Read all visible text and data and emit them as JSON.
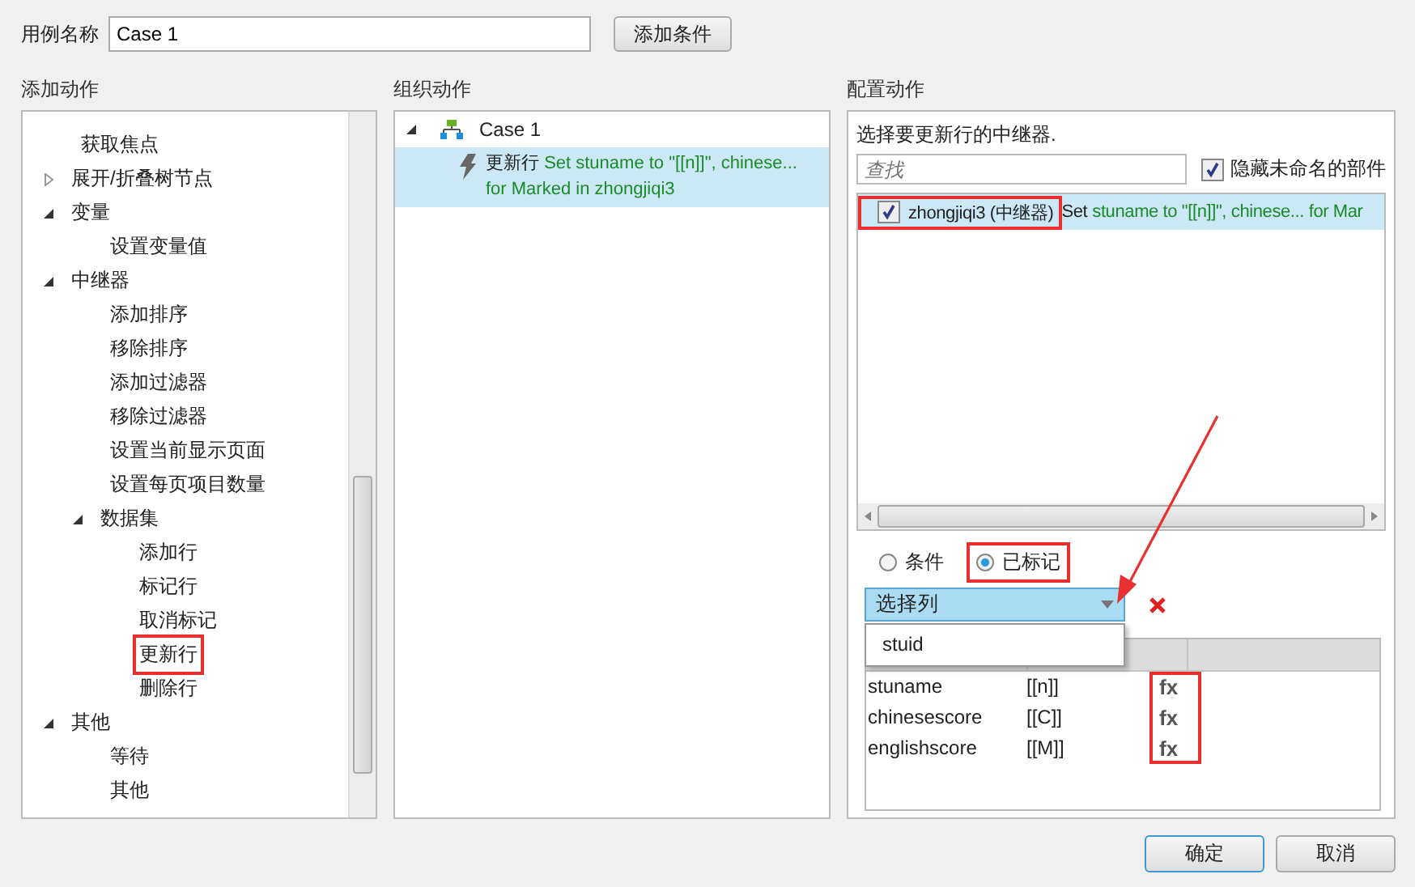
{
  "case_name": {
    "label": "用例名称",
    "value": "Case 1"
  },
  "add_condition_button": "添加条件",
  "add_actions": {
    "title": "添加动作",
    "tree": [
      {
        "label": "获取焦点"
      },
      {
        "label": "展开/折叠树节点",
        "expanded": false
      },
      {
        "label": "变量",
        "expanded": true,
        "children": [
          {
            "label": "设置变量值"
          }
        ]
      },
      {
        "label": "中继器",
        "expanded": true,
        "children": [
          {
            "label": "添加排序"
          },
          {
            "label": "移除排序"
          },
          {
            "label": "添加过滤器"
          },
          {
            "label": "移除过滤器"
          },
          {
            "label": "设置当前显示页面"
          },
          {
            "label": "设置每页项目数量"
          },
          {
            "label": "数据集",
            "expanded": true,
            "children": [
              {
                "label": "添加行",
                "highlighted": false
              },
              {
                "label": "标记行",
                "highlighted": false
              },
              {
                "label": "取消标记",
                "highlighted": false
              },
              {
                "label": "更新行",
                "highlighted": true
              },
              {
                "label": "删除行",
                "highlighted": false
              }
            ]
          }
        ]
      },
      {
        "label": "其他",
        "expanded": true,
        "children": [
          {
            "label": "等待"
          },
          {
            "label": "其他"
          }
        ]
      }
    ]
  },
  "organize_actions": {
    "title": "组织动作",
    "cases": [
      {
        "label": "Case 1",
        "expanded": true,
        "actions": [
          {
            "name": "更新行",
            "description": "Set stuname to \"[[n]]\", chinese...",
            "description_2": "for Marked in zhongjiqi3",
            "selected": true
          }
        ]
      }
    ]
  },
  "configure_actions": {
    "title": "配置动作",
    "prompt": "选择要更新行的中继器.",
    "search": {
      "placeholder": "查找"
    },
    "hide_unnamed": {
      "label": "隐藏未命名的部件",
      "checked": true
    },
    "widgets": [
      {
        "name": "zhongjiqi3 (中继器)",
        "verb": "Set",
        "detail": "stuname to \"[[n]]\", chinese... for Mar",
        "checked": true,
        "selected": true,
        "highlighted": true
      }
    ],
    "target_options": [
      {
        "label": "条件",
        "selected": false,
        "highlighted": false
      },
      {
        "label": "已标记",
        "selected": true,
        "highlighted": true
      }
    ],
    "column_select": {
      "label": "选择列",
      "expanded": true,
      "options": [
        "stuid"
      ]
    },
    "columns_grid": {
      "fx_highlighted": true,
      "rows": [
        {
          "column": "stuname",
          "value": "[[n]]",
          "function": "fx"
        },
        {
          "column": "chinesescore",
          "value": "[[C]]",
          "function": "fx"
        },
        {
          "column": "englishscore",
          "value": "[[M]]",
          "function": "fx"
        }
      ]
    }
  },
  "buttons": [
    {
      "label": "确定",
      "kind": "primary"
    },
    {
      "label": "取消",
      "kind": "default"
    }
  ]
}
